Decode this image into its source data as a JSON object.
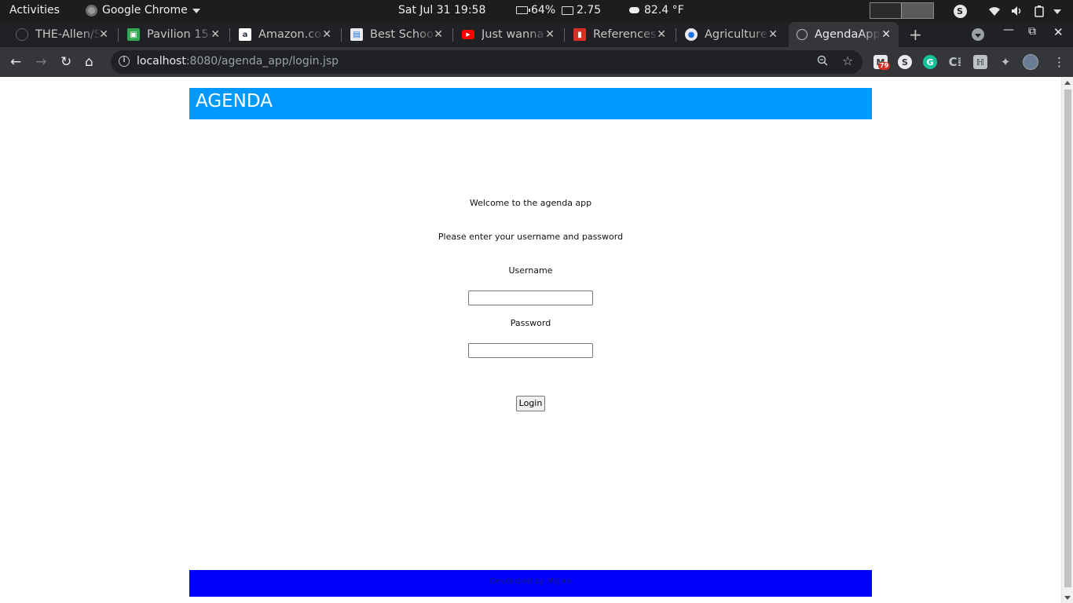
{
  "system_bar": {
    "activities": "Activities",
    "app_name": "Google Chrome",
    "clock": "Sat Jul 31  19:58",
    "battery": "64%",
    "load": "2.75",
    "weather": "82.4 °F"
  },
  "tabs": [
    {
      "title": "THE-Allen/S",
      "favicon": "github-icon",
      "favicon_color": "#202124"
    },
    {
      "title": "Pavilion 15-",
      "favicon": "pavilion-icon",
      "favicon_color": "#34a853"
    },
    {
      "title": "Amazon.co",
      "favicon": "amazon-icon",
      "favicon_color": "#ffffff"
    },
    {
      "title": "Best Schoo",
      "favicon": "school-icon",
      "favicon_color": "#e8eaed"
    },
    {
      "title": "Just wanna",
      "favicon": "youtube-icon",
      "favicon_color": "#ff0000"
    },
    {
      "title": "References",
      "favicon": "references-icon",
      "favicon_color": "#d93025"
    },
    {
      "title": "Agriculture",
      "favicon": "agriculture-icon",
      "favicon_color": "#e8eaed"
    },
    {
      "title": "AgendaApp",
      "favicon": "globe-icon",
      "favicon_color": "#bdc1c6",
      "active": true
    }
  ],
  "toolbar": {
    "url_host": "localhost",
    "url_path": ":8080/agenda_app/login.jsp",
    "gmail_badge": "79"
  },
  "page": {
    "header_title": "AGENDA",
    "welcome": "Welcome to the agenda app",
    "prompt": "Please enter your username and password",
    "username_label": "Username",
    "username_value": "",
    "password_label": "Password",
    "password_value": "",
    "login_button": "Login",
    "footer_text": "Developed by M@ira"
  },
  "colors": {
    "header_bg": "#0099ff",
    "footer_bg": "#0000ff"
  }
}
